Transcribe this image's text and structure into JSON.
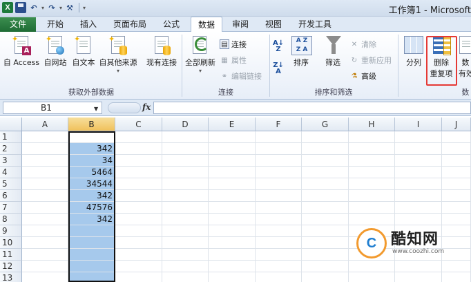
{
  "window": {
    "title": "工作簿1 - Microsoft"
  },
  "quick_access": [
    "excel-logo",
    "save-icon",
    "undo-icon",
    "redo-icon",
    "customize-icon"
  ],
  "tabs": [
    {
      "label": "文件"
    },
    {
      "label": "开始"
    },
    {
      "label": "插入"
    },
    {
      "label": "页面布局"
    },
    {
      "label": "公式"
    },
    {
      "label": "数据",
      "active": true
    },
    {
      "label": "审阅"
    },
    {
      "label": "视图"
    },
    {
      "label": "开发工具"
    }
  ],
  "ribbon": {
    "external": {
      "access": "自 Access",
      "web": "自网站",
      "text": "自文本",
      "other": "自其他来源",
      "existing": "现有连接",
      "group": "获取外部数据"
    },
    "connections": {
      "refresh_all": "全部刷新",
      "connections": "连接",
      "properties": "属性",
      "edit_links": "编辑链接",
      "group": "连接"
    },
    "sort_filter": {
      "sort": "排序",
      "filter": "筛选",
      "clear": "清除",
      "reapply": "重新应用",
      "advanced": "高级",
      "group": "排序和筛选"
    },
    "tools": {
      "text_to_columns": "分列",
      "remove_dup_line1": "删除",
      "remove_dup_line2": "重复项",
      "data_validation_partial": "数",
      "data_validation_partial2": "有效",
      "group_partial": "数"
    }
  },
  "formula_bar": {
    "name_box": "B1",
    "fx": "fx",
    "formula": ""
  },
  "grid": {
    "columns": [
      "A",
      "B",
      "C",
      "D",
      "E",
      "F",
      "G",
      "H",
      "I",
      "J"
    ],
    "rows": [
      "1",
      "2",
      "3",
      "4",
      "5",
      "6",
      "7",
      "8",
      "9",
      "10",
      "11",
      "12",
      "13"
    ],
    "columnB_values": [
      "",
      "342",
      "34",
      "5464",
      "34544",
      "342",
      "47576",
      "342",
      "",
      "",
      "",
      "",
      ""
    ]
  },
  "watermark": {
    "name": "酷知网",
    "url": "www.coozhi.com",
    "logo_letter": "C"
  }
}
